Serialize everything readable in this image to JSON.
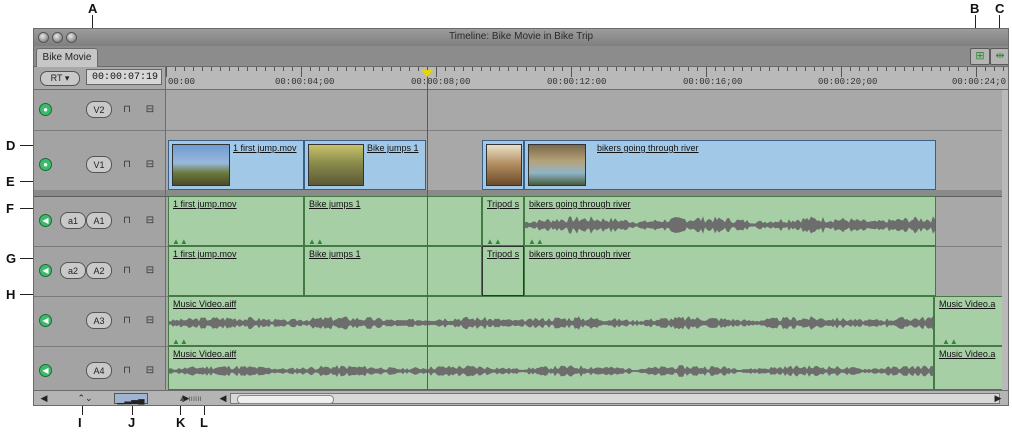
{
  "callouts": [
    "A",
    "B",
    "C",
    "D",
    "E",
    "F",
    "G",
    "H",
    "I",
    "J",
    "K",
    "L"
  ],
  "window": {
    "title": "Timeline: Bike Movie in Bike Trip",
    "sequence_tab": "Bike Movie"
  },
  "ruler": {
    "rt_label": "RT ▾",
    "timecode": "00:00:07:19",
    "ticks": [
      "00:00",
      "00:00:04;00",
      "00:00:08;00",
      "00:00:12:00",
      "00:00:16;00",
      "00:00:20;00",
      "00:00:24;0"
    ]
  },
  "tracks": {
    "v2": {
      "label": "V2"
    },
    "v1": {
      "label": "V1"
    },
    "a1": {
      "source": "a1",
      "label": "A1"
    },
    "a2": {
      "source": "a2",
      "label": "A2"
    },
    "a3": {
      "label": "A3"
    },
    "a4": {
      "label": "A4"
    }
  },
  "clips": {
    "v1": [
      "1 first jump.mov",
      "Bike jumps 1",
      "",
      "bikers going through river"
    ],
    "a1": [
      "1 first jump.mov",
      "Bike jumps 1",
      "Tripod s",
      "bikers going through river"
    ],
    "a2": [
      "1 first jump.mov",
      "Bike jumps 1",
      "Tripod s",
      "bikers going through river"
    ],
    "a3": [
      "Music Video.aiff",
      "Music Video.a"
    ],
    "a4": [
      "Music Video.aiff",
      "Music Video.a"
    ]
  },
  "icons": {
    "visibility": "eye-icon",
    "lock": "lock-icon",
    "link": "link-icon",
    "audio": "speaker-icon"
  },
  "colors": {
    "video_clip": "#a2c8e8",
    "audio_clip": "#a7cfa6",
    "visibility_on": "#3dbb6c",
    "playhead": "#e8d600"
  }
}
